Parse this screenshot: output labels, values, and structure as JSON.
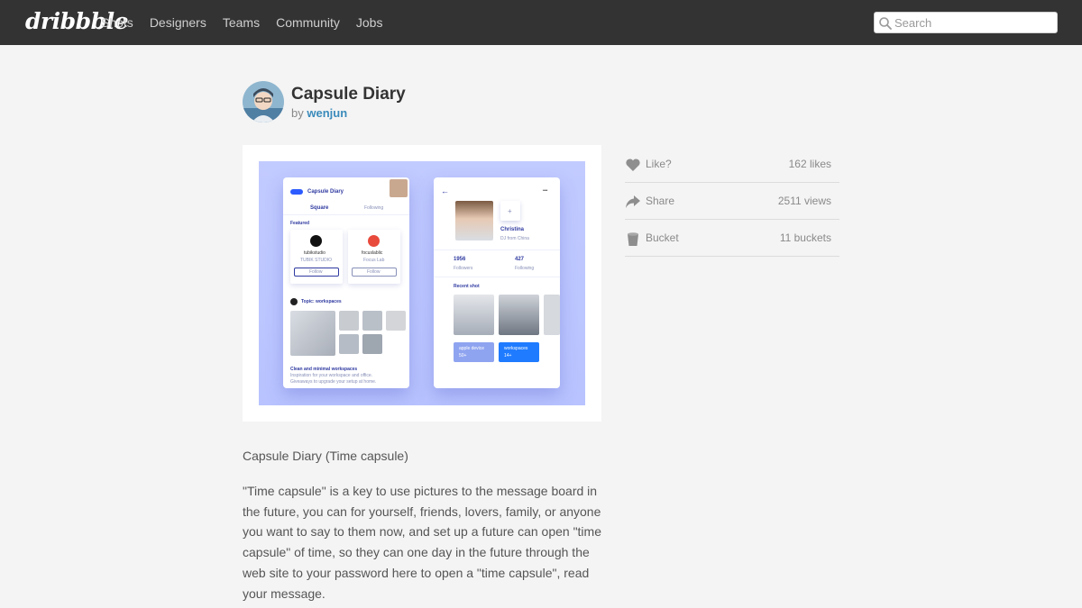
{
  "nav": {
    "logo": "dribbble",
    "links": [
      "Shots",
      "Designers",
      "Teams",
      "Community",
      "Jobs"
    ],
    "search_placeholder": "Search",
    "search_value": ""
  },
  "shot": {
    "title": "Capsule Diary",
    "by_prefix": "by",
    "author": "wenjun"
  },
  "mockup": {
    "left": {
      "app_name": "Capsule Diary",
      "tabs": [
        "Square",
        "Following"
      ],
      "featured_label": "Featured",
      "cards": [
        {
          "name": "tubikstudio",
          "sub": "TUBIK STUDIO",
          "button": "Follow"
        },
        {
          "name": "focuslablic",
          "sub": "Focus Lab",
          "button": "Follow"
        }
      ],
      "topic": "Topic: workspaces",
      "footer_title": "Clean and minimal workspaces",
      "footer_text_1": "Inspiration for your workspace and office.",
      "footer_text_2": "Giveaways to upgrade your setup at home."
    },
    "right": {
      "back": "←",
      "more": "•••",
      "plus": "+",
      "profile_name": "Christina",
      "profile_sub": "DJ from China",
      "followers_value": "1956",
      "followers_label": "Followers",
      "following_value": "427",
      "following_label": "Following",
      "recent_label": "Recent shot",
      "chip1_a": "apple device",
      "chip1_b": "50+",
      "chip2_a": "workspaces",
      "chip2_b": "14+"
    }
  },
  "stats": [
    {
      "label": "Like?",
      "value": "162 likes",
      "icon": "heart-icon"
    },
    {
      "label": "Share",
      "value": "2511 views",
      "icon": "share-icon"
    },
    {
      "label": "Bucket",
      "value": "11 buckets",
      "icon": "bucket-icon"
    }
  ],
  "description": {
    "title": "Capsule Diary (Time capsule)",
    "body": "\"Time capsule\" is a key to use pictures to the message board in the future, you can for yourself, friends, lovers, family, or anyone you want to say to them now, and set up a future can open \"time capsule\" of time, so they can one day in the future through the web site to your password here to open a \"time capsule\", read your message."
  },
  "colors": {
    "topbar": "#333333",
    "page_bg": "#f4f4f4",
    "link": "#3a8bbb",
    "shot_bg": "#c2cbff",
    "accent_blue": "#1f7bff"
  }
}
